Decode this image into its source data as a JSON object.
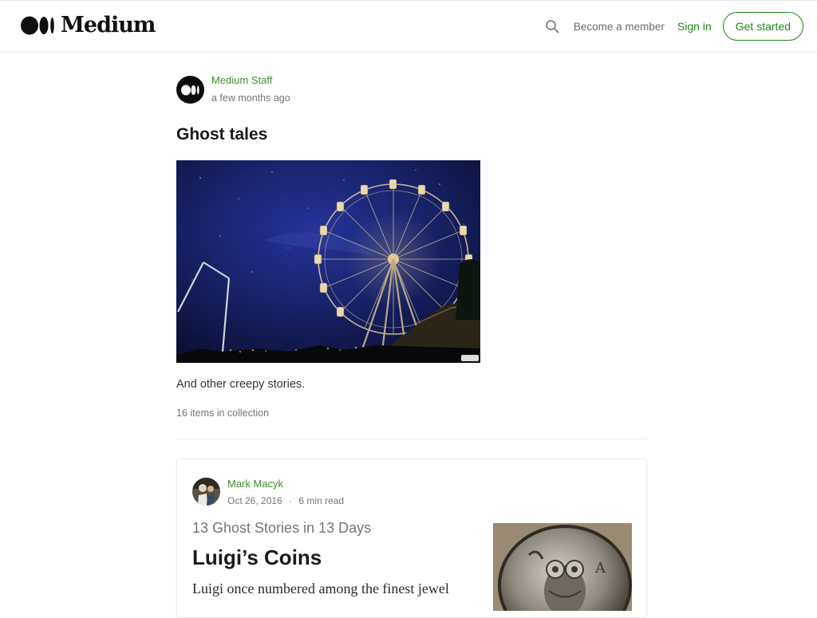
{
  "header": {
    "logo_text": "Medium",
    "nav": {
      "member_label": "Become a member",
      "signin_label": "Sign in",
      "getstarted_label": "Get started"
    },
    "accent_color": "#1a8917"
  },
  "collection": {
    "author": "Medium Staff",
    "posted": "a few months ago",
    "title": "Ghost tales",
    "description": "And other creepy stories.",
    "count": "16 items in collection"
  },
  "story": {
    "author": "Mark Macyk",
    "date": "Oct 26, 2016",
    "separator": "·",
    "read_time": "6 min read",
    "kicker": "13 Ghost Stories in 13 Days",
    "title": "Luigi’s Coins",
    "snippet": "Luigi once numbered among the finest jewel"
  }
}
